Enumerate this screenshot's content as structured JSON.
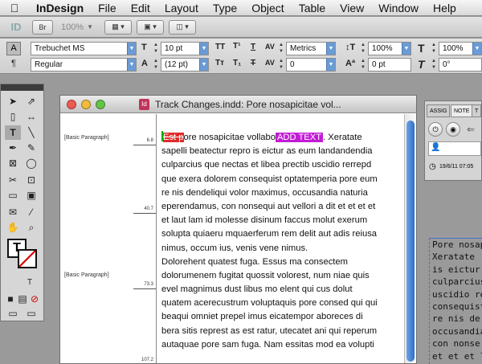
{
  "menubar": {
    "items": [
      "InDesign",
      "File",
      "Edit",
      "Layout",
      "Type",
      "Object",
      "Table",
      "View",
      "Window",
      "Help"
    ]
  },
  "appbar": {
    "logo": "ID",
    "bridge_label": "Br",
    "zoom": "100%"
  },
  "control": {
    "font_family": "Trebuchet MS",
    "font_style": "Regular",
    "font_size": "10 pt",
    "leading": "(12 pt)",
    "kerning": "Metrics",
    "tracking": "0",
    "vscale": "100%",
    "hscale": "100%",
    "baseline": "0 pt",
    "skew": "0°"
  },
  "document": {
    "title": "Track Changes.indd: Pore nosapicitae vol...",
    "file_icon": "Id",
    "paragraph_styles": [
      {
        "label": "[Basic Paragraph]"
      },
      {
        "label": "[Basic Paragraph]"
      }
    ],
    "depth_marks": [
      "6.8",
      "40.7",
      "73.3",
      "107.2"
    ],
    "first_line": {
      "deleted": "Est p",
      "rest": "ore nosapicitae vollabo",
      "added": "ADD TEXT",
      "tail": ". Xeratate"
    },
    "lines": [
      "sapelli beatectur repro is eictur as eum landandendia",
      "culparcius que nectas et libea prectib uscidio rerrepd",
      "que exera dolorem consequist optatemperia pore eum",
      "re nis dendeliqui volor maximus, occusandia naturia",
      "eperendamus, con nonsequi aut vellori a dit et et et et",
      "et laut lam id molesse disinum faccus molut exerum",
      "solupta quiaeru mquaerferum rem delit aut adis reiusa",
      "nimus, occum ius, venis vene nimus.",
      "Dolorehent quatest fuga. Essus ma consectem",
      "dolorumenem fugitat quossit volorest, num niae quis",
      "evel magnimus dust libus mo elent qui cus dolut",
      "quatem acerecustrum voluptaquis pore consed qui qui",
      "beaqui omniet prepel imus eicatempor aboreces di",
      "bera sitis represt as est ratur, utecatet ani qui reperum",
      "autaquae pore sam fuga. Nam essitas mod ea volupti"
    ]
  },
  "right_panel": {
    "tab1": "ASSIG",
    "tab2": "NOTE",
    "tab3": "T",
    "date": "19/6/11 07:05"
  },
  "pasteboard": {
    "lines": [
      "Pore nosap",
      "Xeratate",
      "is eictur",
      "culparcius",
      "uscidio re",
      "consequist",
      "re nis de",
      "occusandia",
      "con nonse",
      "et et et la"
    ]
  },
  "colors": {
    "deleted_bg": "#e02a2a",
    "added_bg": "#c21bd6",
    "cursor": "#00aa00"
  }
}
